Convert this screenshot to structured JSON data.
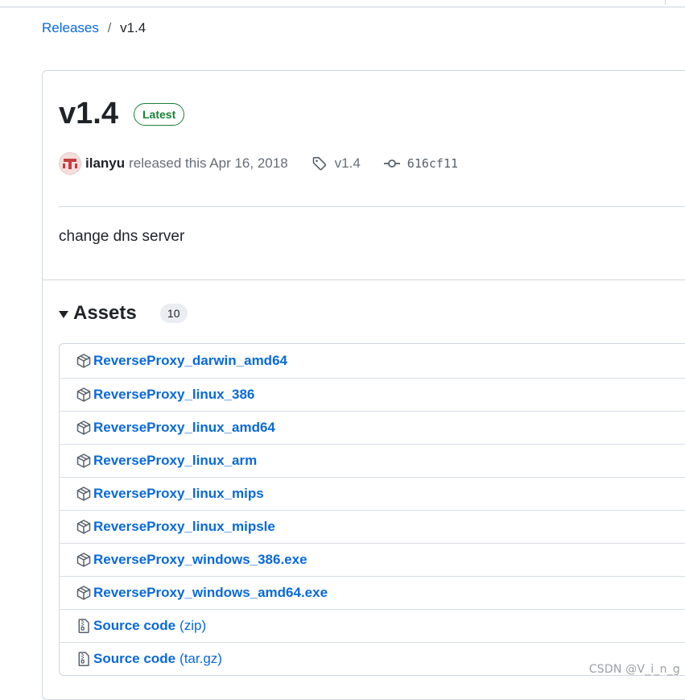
{
  "breadcrumb": {
    "releases_label": "Releases",
    "separator": "/",
    "current": "v1.4"
  },
  "release": {
    "title": "v1.4",
    "badge": "Latest",
    "author": "ilanyu",
    "released_text": "released this Apr 16, 2018",
    "tag": "v1.4",
    "commit": "616cf11",
    "notes": "change dns server",
    "icons": {
      "tag": "tag-icon",
      "commit": "git-commit-icon"
    }
  },
  "assets": {
    "title": "Assets",
    "count": "10",
    "items": [
      {
        "name": "ReverseProxy_darwin_amd64",
        "suffix": "",
        "icon": "package-icon"
      },
      {
        "name": "ReverseProxy_linux_386",
        "suffix": "",
        "icon": "package-icon"
      },
      {
        "name": "ReverseProxy_linux_amd64",
        "suffix": "",
        "icon": "package-icon"
      },
      {
        "name": "ReverseProxy_linux_arm",
        "suffix": "",
        "icon": "package-icon"
      },
      {
        "name": "ReverseProxy_linux_mips",
        "suffix": "",
        "icon": "package-icon"
      },
      {
        "name": "ReverseProxy_linux_mipsle",
        "suffix": "",
        "icon": "package-icon"
      },
      {
        "name": "ReverseProxy_windows_386.exe",
        "suffix": "",
        "icon": "package-icon"
      },
      {
        "name": "ReverseProxy_windows_amd64.exe",
        "suffix": "",
        "icon": "package-icon"
      },
      {
        "name": "Source code",
        "suffix": "(zip)",
        "icon": "file-zip-icon"
      },
      {
        "name": "Source code",
        "suffix": "(tar.gz)",
        "icon": "file-zip-icon"
      }
    ]
  },
  "watermark": "CSDN @V_i_n_g",
  "colors": {
    "link": "#0969da",
    "latest": "#1a7f37",
    "text": "#1f2328",
    "muted": "#656d76"
  }
}
